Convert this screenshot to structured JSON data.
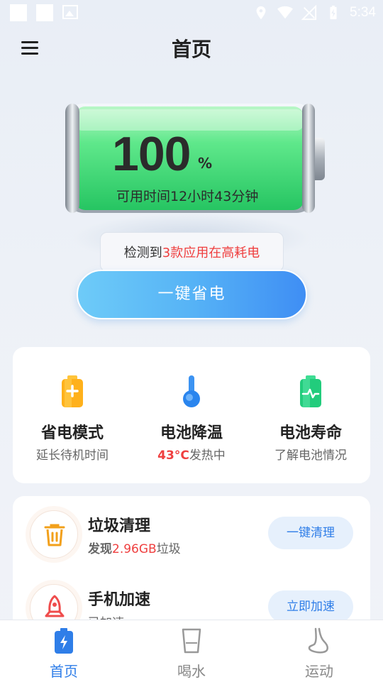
{
  "status_bar": {
    "time": "5:34"
  },
  "header": {
    "title": "首页"
  },
  "battery": {
    "percent": "100",
    "unit": "%",
    "level": 1.0,
    "available_time": "可用时间12小时43分钟"
  },
  "alert": {
    "prefix": "检测到",
    "highlight": "3款应用在高耗电"
  },
  "primary_button": {
    "label": "一键省电"
  },
  "features": [
    {
      "title": "省电模式",
      "subtitle": "延长待机时间",
      "icon": "battery-save-icon"
    },
    {
      "title": "电池降温",
      "subtitle_highlight": "43°C",
      "subtitle_rest": "发热中",
      "icon": "thermometer-icon"
    },
    {
      "title": "电池寿命",
      "subtitle": "了解电池情况",
      "icon": "battery-health-icon"
    }
  ],
  "tools": [
    {
      "title": "垃圾清理",
      "sub_prefix": "发现",
      "sub_highlight": "2.96GB",
      "sub_suffix": "垃圾",
      "button": "一键清理",
      "icon": "trash-icon"
    },
    {
      "title": "手机加速",
      "subtitle": "已加速",
      "button": "立即加速",
      "icon": "rocket-icon"
    }
  ],
  "bottom_nav": [
    {
      "label": "首页",
      "icon": "battery-bolt-icon",
      "active": true
    },
    {
      "label": "喝水",
      "icon": "water-cup-icon",
      "active": false
    },
    {
      "label": "运动",
      "icon": "foot-icon",
      "active": false
    }
  ],
  "colors": {
    "accent": "#2f7ee8",
    "warning_red": "#ef3f3f",
    "battery_green": "#38d878",
    "save_orange": "#ffb11b"
  }
}
